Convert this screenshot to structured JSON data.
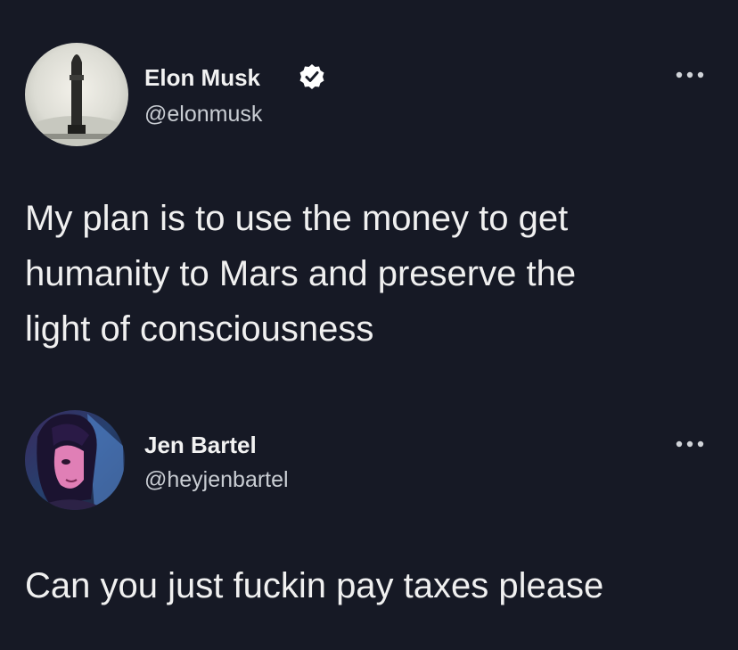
{
  "tweets": [
    {
      "name": "Elon Musk",
      "handle": "@elonmusk",
      "verified": true,
      "text_lines": [
        "My plan is to use the money to get",
        "humanity to Mars and preserve the",
        "light of consciousness"
      ],
      "more_icon": "ellipsis-icon"
    },
    {
      "name": "Jen Bartel",
      "handle": "@heyjenbartel",
      "verified": false,
      "text_lines": [
        "Can you just fuckin pay taxes please"
      ],
      "more_icon": "ellipsis-icon"
    }
  ],
  "colors": {
    "background": "#161925",
    "text": "#f0f0f0",
    "handle": "#c9cdd3",
    "verified": "#ffffff"
  }
}
